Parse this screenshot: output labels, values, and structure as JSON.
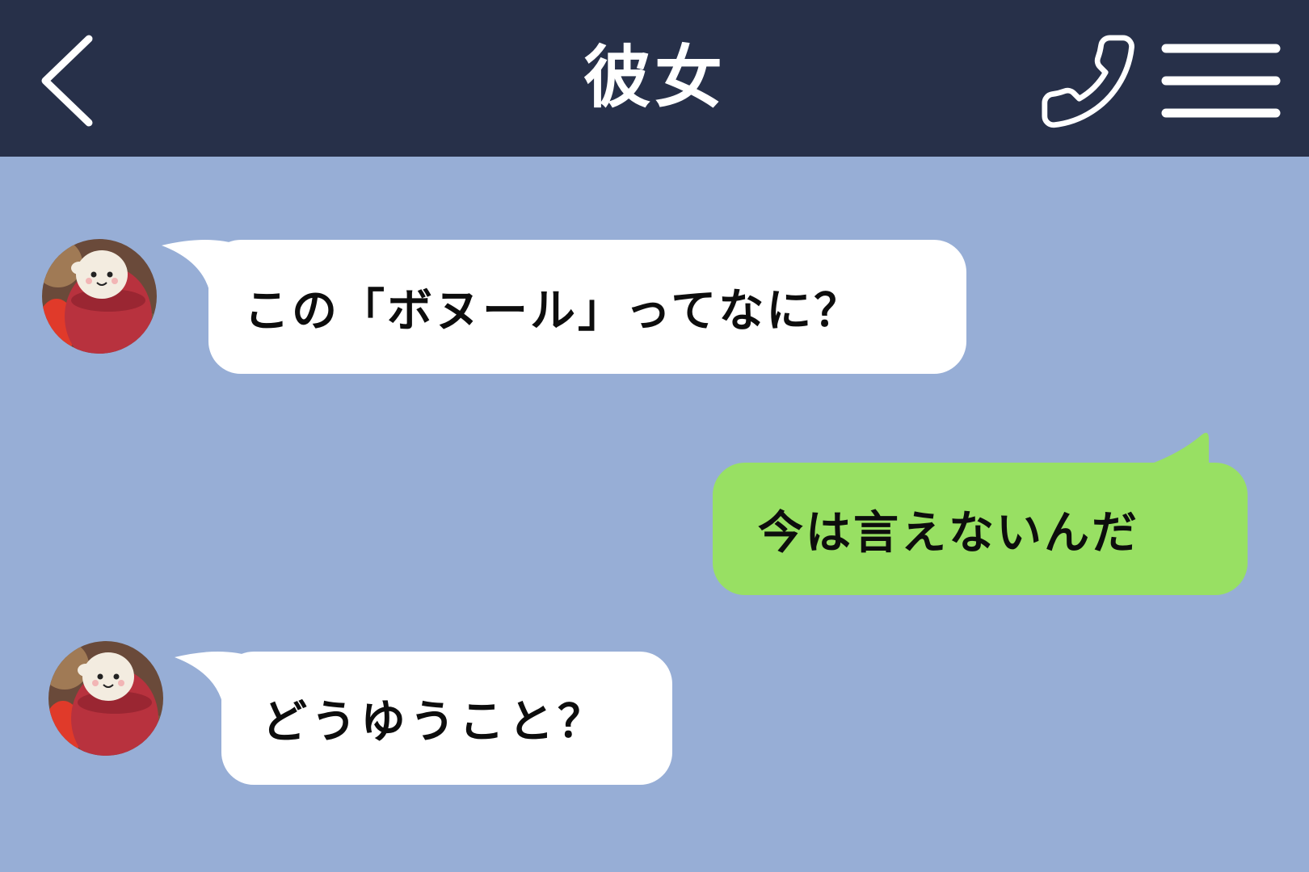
{
  "header": {
    "title": "彼女",
    "back_icon": "chevron-left-icon",
    "call_icon": "phone-icon",
    "menu_icon": "hamburger-menu-icon"
  },
  "messages": [
    {
      "sender": "them",
      "text": "この「ボヌール」ってなに？"
    },
    {
      "sender": "me",
      "text": "今は言えないんだ"
    },
    {
      "sender": "them",
      "text": "どうゆうこと？"
    }
  ],
  "colors": {
    "header_bg": "#273049",
    "chat_bg": "#97aed6",
    "incoming_bubble": "#ffffff",
    "outgoing_bubble": "#98e063",
    "header_fg": "#ffffff",
    "text": "#0d0d0d"
  }
}
